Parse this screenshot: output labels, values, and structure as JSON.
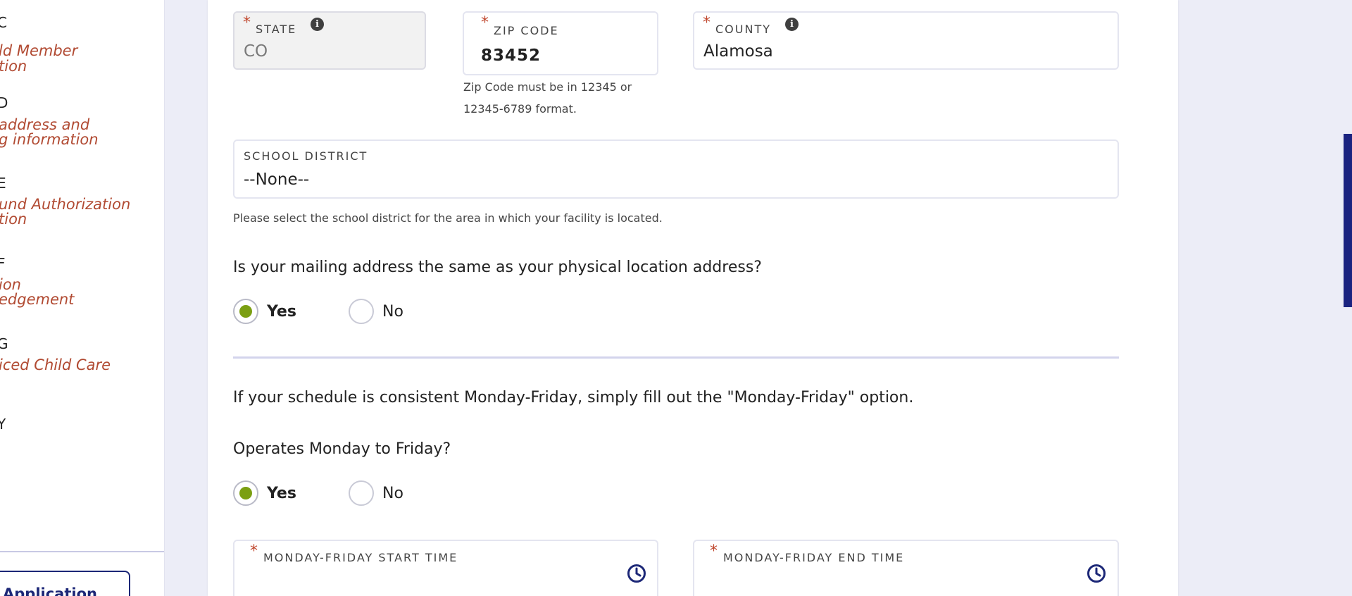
{
  "sidebar": {
    "steps": [
      {
        "letter": "C",
        "title_lines": [
          "ld Member",
          "tion"
        ]
      },
      {
        "letter": "D",
        "title_lines": [
          " address and",
          "g information"
        ]
      },
      {
        "letter": "E",
        "title_lines": [
          "und Authorization",
          "tion"
        ]
      },
      {
        "letter": "F",
        "title_lines": [
          "ion",
          "edgement"
        ]
      },
      {
        "letter": "G",
        "title_lines": [
          "iced Child Care"
        ]
      },
      {
        "letter": "Y",
        "title_lines": []
      }
    ],
    "application_button_label": "Application"
  },
  "form": {
    "state": {
      "label": "STATE",
      "value": "CO",
      "info_icon": "info-icon",
      "disabled": true
    },
    "zip": {
      "label": "ZIP CODE",
      "value": "83452",
      "help_line1": "Zip Code must be in 12345 or",
      "help_line2": "12345-6789 format."
    },
    "county": {
      "label": "COUNTY",
      "value": "Alamosa",
      "info_icon": "info-icon"
    },
    "school_district": {
      "label": "SCHOOL DISTRICT",
      "value": "--None--",
      "help": "Please select the school district for the area in which your facility is located."
    },
    "mailing_question": "Is your mailing address the same as your physical location address?",
    "mailing_options": {
      "yes": "Yes",
      "no": "No",
      "selected": "Yes"
    },
    "schedule_note": "If your schedule is consistent Monday-Friday, simply fill out the \"Monday-Friday\" option.",
    "operates_question": "Operates Monday to Friday?",
    "operates_options": {
      "yes": "Yes",
      "no": "No",
      "selected": "Yes"
    },
    "start_time": {
      "label": "MONDAY-FRIDAY START TIME",
      "value": "",
      "icon": "clock-icon"
    },
    "end_time": {
      "label": "MONDAY-FRIDAY END TIME",
      "value": "",
      "icon": "clock-icon"
    }
  },
  "colors": {
    "accent_navy": "#1c2777",
    "required_red": "#c0472e",
    "radio_green": "#7b9f12",
    "sidebar_title": "#b14a32",
    "background": "#ecedf7"
  }
}
